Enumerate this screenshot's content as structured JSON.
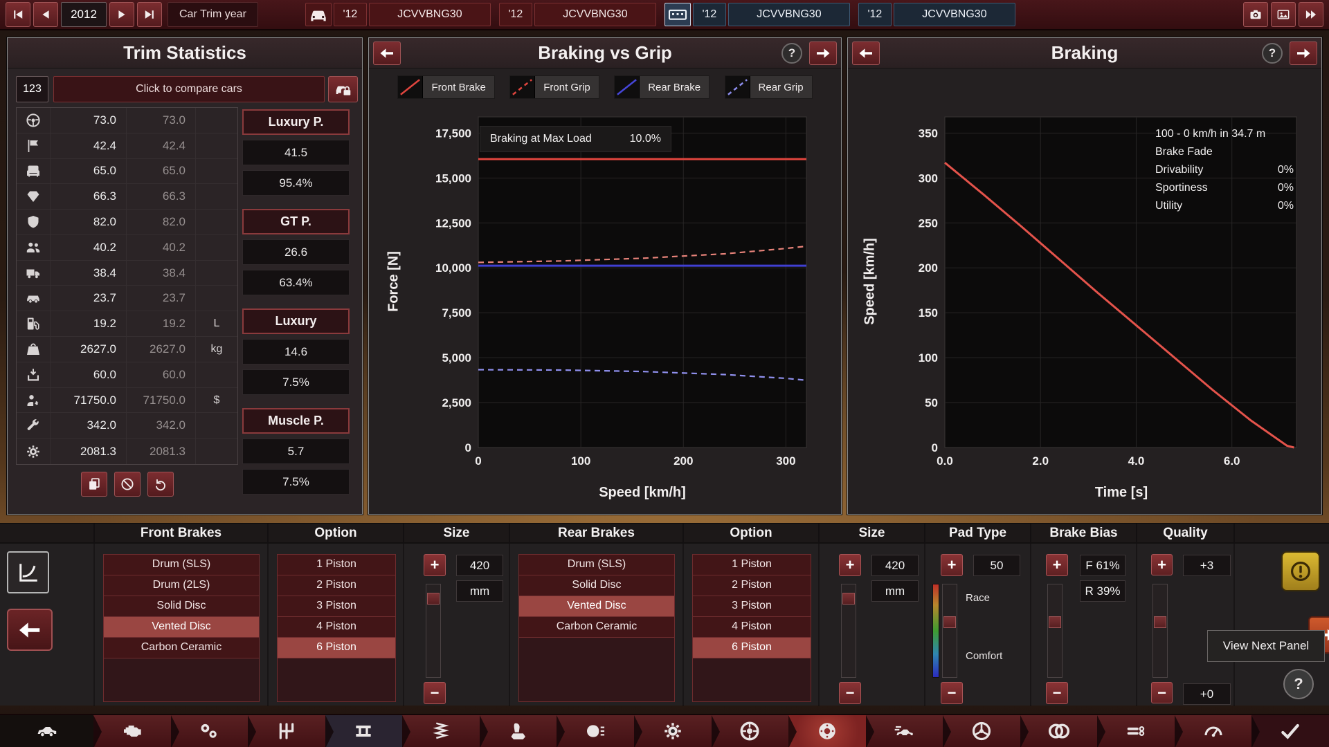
{
  "top_bar": {
    "year": "2012",
    "year_label": "Car Trim year",
    "nav": {
      "first": "skip-back-icon",
      "prev": "step-back-icon",
      "next": "step-fwd-icon",
      "last": "skip-fwd-icon"
    },
    "tabs": [
      {
        "icon": "car-front-icon",
        "year": "'12",
        "name": "JCVVBNG30",
        "theme": "red"
      },
      {
        "year": "'12",
        "name": "JCVVBNG30",
        "theme": "red"
      },
      {
        "icon": "platform-icon",
        "year": "'12",
        "name": "JCVVBNG30",
        "theme": "blue"
      },
      {
        "year": "'12",
        "name": "JCVVBNG30",
        "theme": "blue"
      }
    ],
    "right_buttons": [
      {
        "icon": "camera-icon"
      },
      {
        "icon": "photo-icon"
      },
      {
        "icon": "fast-forward-icon"
      }
    ]
  },
  "trim_stats": {
    "title": "Trim Statistics",
    "compare_number": "123",
    "compare_label": "Click to compare cars",
    "compare_lock_icon": "car-lock-icon",
    "rows": [
      {
        "icon": "steering-wheel-icon",
        "v1": "73.0",
        "v2": "73.0",
        "unit": ""
      },
      {
        "icon": "checkered-flag-icon",
        "v1": "42.4",
        "v2": "42.4",
        "unit": ""
      },
      {
        "icon": "comfort-seat-icon",
        "v1": "65.0",
        "v2": "65.0",
        "unit": ""
      },
      {
        "icon": "prestige-gem-icon",
        "v1": "66.3",
        "v2": "66.3",
        "unit": ""
      },
      {
        "icon": "safety-shield-icon",
        "v1": "82.0",
        "v2": "82.0",
        "unit": ""
      },
      {
        "icon": "practicality-people-icon",
        "v1": "40.2",
        "v2": "40.2",
        "unit": ""
      },
      {
        "icon": "utility-truck-icon",
        "v1": "38.4",
        "v2": "38.4",
        "unit": ""
      },
      {
        "icon": "offroad-icon",
        "v1": "23.7",
        "v2": "23.7",
        "unit": ""
      },
      {
        "icon": "fuel-pump-icon",
        "v1": "19.2",
        "v2": "19.2",
        "unit": "L"
      },
      {
        "icon": "weight-icon",
        "v1": "2627.0",
        "v2": "2627.0",
        "unit": "kg"
      },
      {
        "icon": "cargo-icon",
        "v1": "60.0",
        "v2": "60.0",
        "unit": ""
      },
      {
        "icon": "engineering-icon",
        "v1": "71750.0",
        "v2": "71750.0",
        "unit": "$"
      },
      {
        "icon": "service-wrench-icon",
        "v1": "342.0",
        "v2": "342.0",
        "unit": ""
      },
      {
        "icon": "production-gear-icon",
        "v1": "2081.3",
        "v2": "2081.3",
        "unit": ""
      }
    ],
    "footer_buttons": [
      {
        "icon": "copy-icon"
      },
      {
        "icon": "ban-icon"
      },
      {
        "icon": "undo-icon"
      }
    ],
    "competitors": [
      {
        "name": "Luxury P.",
        "score": "41.5",
        "share": "95.4%"
      },
      {
        "name": "GT P.",
        "score": "26.6",
        "share": "63.4%"
      },
      {
        "name": "Luxury",
        "score": "14.6",
        "share": "7.5%"
      },
      {
        "name": "Muscle P.",
        "score": "5.7",
        "share": "7.5%"
      }
    ]
  },
  "braking_vs_grip": {
    "title": "Braking vs Grip",
    "help": "?",
    "legend": [
      {
        "label": "Front Brake",
        "color": "#e0453e",
        "dash": false
      },
      {
        "label": "Front Grip",
        "color": "#e0453e",
        "dash": true
      },
      {
        "label": "Rear Brake",
        "color": "#4646d8",
        "dash": false
      },
      {
        "label": "Rear Grip",
        "color": "#8c8cec",
        "dash": true
      }
    ],
    "overlay": {
      "label": "Braking at Max Load",
      "value": "10.0%"
    },
    "xlabel": "Speed [km/h]",
    "ylabel": "Force [N]",
    "chart_data": {
      "type": "line",
      "xlim": [
        0,
        320
      ],
      "ylim": [
        0,
        18400
      ],
      "xticks": [
        0,
        100,
        200,
        300
      ],
      "xtick_labels": [
        "0",
        "100",
        "200",
        "300"
      ],
      "yticks": [
        0,
        2500,
        5000,
        7500,
        10000,
        12500,
        15000,
        17500
      ],
      "ytick_labels": [
        "0",
        "2,500",
        "5,000",
        "7,500",
        "10,000",
        "12,500",
        "15,000",
        "17,500"
      ],
      "series": [
        {
          "name": "Front Brake",
          "color": "#e0453e",
          "dash": null,
          "width": 3,
          "points": [
            [
              0,
              16050
            ],
            [
              320,
              16050
            ]
          ]
        },
        {
          "name": "Rear Brake",
          "color": "#4040d2",
          "dash": null,
          "width": 3,
          "points": [
            [
              0,
              10120
            ],
            [
              320,
              10120
            ]
          ]
        },
        {
          "name": "Front Grip",
          "color": "#e8837a",
          "dash": [
            8,
            6
          ],
          "width": 2.2,
          "points": [
            [
              0,
              10300
            ],
            [
              80,
              10380
            ],
            [
              160,
              10530
            ],
            [
              240,
              10780
            ],
            [
              300,
              11080
            ],
            [
              320,
              11200
            ]
          ]
        },
        {
          "name": "Rear Grip",
          "color": "#9090ee",
          "dash": [
            8,
            6
          ],
          "width": 2.2,
          "points": [
            [
              0,
              4330
            ],
            [
              80,
              4310
            ],
            [
              160,
              4230
            ],
            [
              240,
              4060
            ],
            [
              300,
              3850
            ],
            [
              320,
              3740
            ]
          ]
        }
      ]
    }
  },
  "braking": {
    "title": "Braking",
    "help": "?",
    "xlabel": "Time [s]",
    "ylabel": "Speed [km/h]",
    "info": {
      "distance": "100 - 0 km/h in 34.7 m",
      "fade_label": "Brake Fade",
      "rows": [
        {
          "label": "Drivability",
          "value": "0%"
        },
        {
          "label": "Sportiness",
          "value": "0%"
        },
        {
          "label": "Utility",
          "value": "0%"
        }
      ]
    },
    "chart_data": {
      "type": "line",
      "xlim": [
        0,
        7.35
      ],
      "ylim": [
        0,
        368
      ],
      "xticks": [
        0,
        2,
        4,
        6
      ],
      "xtick_labels": [
        "0.0",
        "2.0",
        "4.0",
        "6.0"
      ],
      "yticks": [
        0,
        50,
        100,
        150,
        200,
        250,
        300,
        350
      ],
      "ytick_labels": [
        "0",
        "50",
        "100",
        "150",
        "200",
        "250",
        "300",
        "350"
      ],
      "series": [
        {
          "name": "Speed",
          "color": "#e4534b",
          "dash": null,
          "width": 3,
          "points": [
            [
              0,
              317
            ],
            [
              0.8,
              282
            ],
            [
              1.6,
              246
            ],
            [
              2.4,
              209
            ],
            [
              3.2,
              172
            ],
            [
              4,
              136
            ],
            [
              4.8,
              100
            ],
            [
              5.6,
              64
            ],
            [
              6.4,
              30
            ],
            [
              7.15,
              2
            ],
            [
              7.3,
              0
            ]
          ]
        }
      ]
    }
  },
  "config": {
    "plus": "+",
    "minus": "−",
    "mini": [
      {
        "icon": "curve-chart-icon"
      },
      {
        "icon": "arrow-left-big-icon"
      }
    ],
    "front_brakes": {
      "header": "Front Brakes",
      "options": [
        {
          "label": "Drum (SLS)"
        },
        {
          "label": "Drum (2LS)"
        },
        {
          "label": "Solid Disc"
        },
        {
          "label": "Vented Disc",
          "selected": true
        },
        {
          "label": "Carbon Ceramic"
        }
      ]
    },
    "front_option": {
      "header": "Option",
      "options": [
        {
          "label": "1 Piston"
        },
        {
          "label": "2 Piston"
        },
        {
          "label": "3 Piston"
        },
        {
          "label": "4 Piston"
        },
        {
          "label": "6 Piston",
          "selected": true
        }
      ]
    },
    "front_size": {
      "header": "Size",
      "value": "420",
      "unit": "mm"
    },
    "rear_brakes": {
      "header": "Rear Brakes",
      "options": [
        {
          "label": "Drum (SLS)"
        },
        {
          "label": "Solid Disc"
        },
        {
          "label": "Vented Disc",
          "selected": true
        },
        {
          "label": "Carbon Ceramic"
        }
      ]
    },
    "rear_option": {
      "header": "Option",
      "options": [
        {
          "label": "1 Piston"
        },
        {
          "label": "2 Piston"
        },
        {
          "label": "3 Piston"
        },
        {
          "label": "4 Piston"
        },
        {
          "label": "6 Piston",
          "selected": true
        }
      ]
    },
    "rear_size": {
      "header": "Size",
      "value": "420",
      "unit": "mm"
    },
    "pad": {
      "header": "Pad Type",
      "value": "50",
      "top_label": "Race",
      "bottom_label": "Comfort"
    },
    "bias": {
      "header": "Brake Bias",
      "front": "F 61%",
      "rear": "R 39%"
    },
    "quality": {
      "header": "Quality",
      "value": "+3",
      "secondary": "+0"
    },
    "warning_icon": "warning-icon",
    "next_panel_icon": "arrow-right-big-icon",
    "tooltip": "View Next Panel",
    "help": "?"
  },
  "toolbar": {
    "items": [
      {
        "name": "toolbar-item-car-body",
        "icon": "car-body-icon",
        "state": "start"
      },
      {
        "name": "toolbar-item-engine",
        "icon": "engine-icon",
        "state": ""
      },
      {
        "name": "toolbar-item-drivetrain",
        "icon": "drivetrain-icon",
        "state": ""
      },
      {
        "name": "toolbar-item-gearbox",
        "icon": "gearbox-icon",
        "state": ""
      },
      {
        "name": "toolbar-item-chassis",
        "icon": "chassis-icon",
        "state": "muted"
      },
      {
        "name": "toolbar-item-suspension",
        "icon": "suspension-icon",
        "state": ""
      },
      {
        "name": "toolbar-item-interior",
        "icon": "interior-icon",
        "state": ""
      },
      {
        "name": "toolbar-item-lights",
        "icon": "lights-icon",
        "state": ""
      },
      {
        "name": "toolbar-item-safety",
        "icon": "safety-gear-icon",
        "state": ""
      },
      {
        "name": "toolbar-item-wheels",
        "icon": "wheels-icon",
        "state": ""
      },
      {
        "name": "toolbar-item-brakes",
        "icon": "brakes-icon",
        "state": "active"
      },
      {
        "name": "toolbar-item-aero",
        "icon": "aero-icon",
        "state": ""
      },
      {
        "name": "toolbar-item-rims",
        "icon": "rims-icon",
        "state": ""
      },
      {
        "name": "toolbar-item-tyres",
        "icon": "tyres-icon",
        "state": ""
      },
      {
        "name": "toolbar-item-exhaust",
        "icon": "exhaust-icon",
        "state": ""
      },
      {
        "name": "toolbar-item-testing",
        "icon": "testing-icon",
        "state": ""
      },
      {
        "name": "toolbar-item-confirm",
        "icon": "confirm-check-icon",
        "state": "end"
      }
    ]
  }
}
